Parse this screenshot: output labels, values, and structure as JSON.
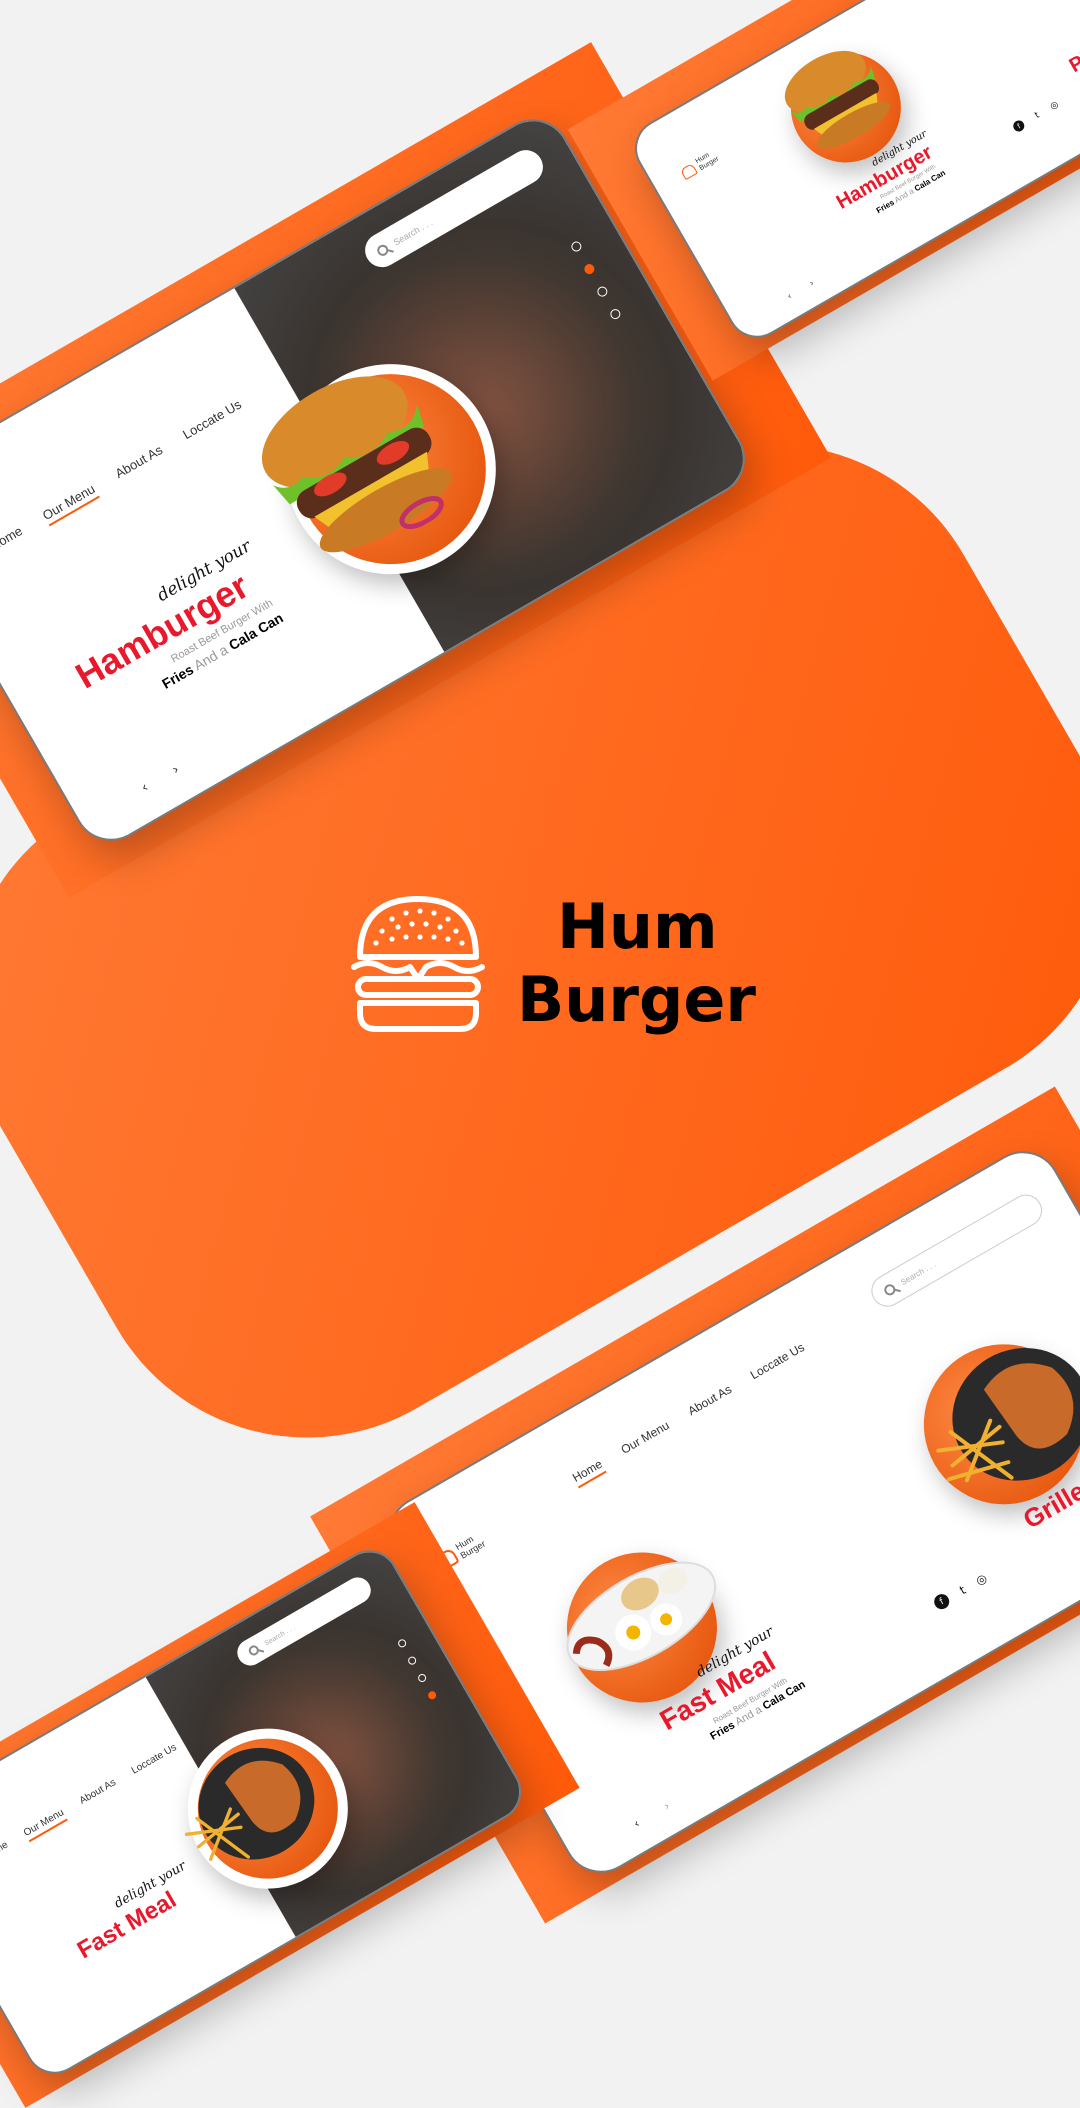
{
  "brand": {
    "name_line1": "Hum",
    "name_line2": "Burger",
    "icon": "burger-icon"
  },
  "nav": {
    "home": "Home",
    "menu": "Our Menu",
    "about": "About As",
    "locate": "Loccate Us"
  },
  "search": {
    "placeholder": "Search . . ."
  },
  "hero_burger": {
    "tagline": "delight your",
    "title": "Hamburger",
    "sub_line1": "Roast Beef Burger With",
    "sub_fries": "Fries",
    "sub_and": "And a",
    "sub_cola": "Cala Can"
  },
  "hero_fastmeal": {
    "tagline": "delight your",
    "title": "Fast Meal",
    "sub_line1": "Roast Beef Burger With",
    "sub_fries": "Fries",
    "sub_and": "And a",
    "sub_cola": "Cala Can"
  },
  "hero_chicken": {
    "title": "Grilled Chicken"
  },
  "hero_pizza": {
    "title": "Pizza"
  },
  "social": {
    "facebook": "f",
    "twitter": "t",
    "instagram": "◎"
  },
  "arrows": {
    "prev": "‹",
    "next": "›"
  },
  "colors": {
    "accent": "#ff5a0a",
    "title_red": "#e8192c"
  }
}
